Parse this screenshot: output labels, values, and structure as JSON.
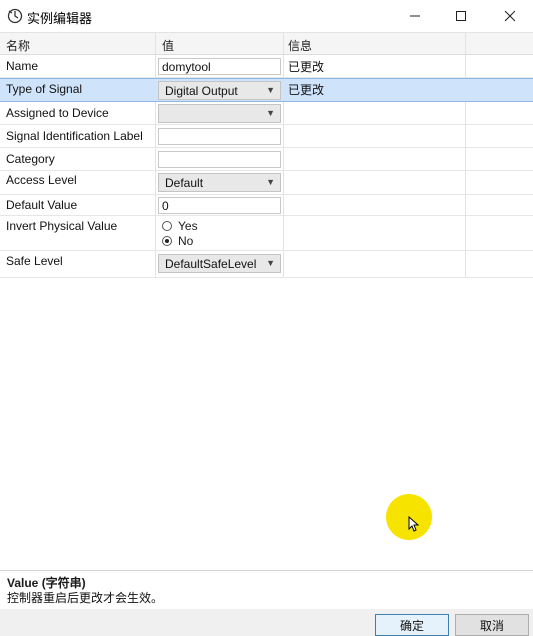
{
  "window": {
    "title": "实例编辑器"
  },
  "columns": {
    "name": "名称",
    "value": "值",
    "info": "信息"
  },
  "rows": [
    {
      "label": "Name",
      "value": "domytool",
      "info": "已更改"
    },
    {
      "label": "Type of Signal",
      "value": "Digital Output",
      "info": "已更改"
    },
    {
      "label": "Assigned to Device",
      "value": "",
      "info": ""
    },
    {
      "label": "Signal Identification Label",
      "value": "",
      "info": ""
    },
    {
      "label": "Category",
      "value": "",
      "info": ""
    },
    {
      "label": "Access Level",
      "value": "Default",
      "info": ""
    },
    {
      "label": "Default Value",
      "value": "0",
      "info": ""
    },
    {
      "label": "Invert Physical Value",
      "options": [
        "Yes",
        "No"
      ],
      "selected": "No",
      "info": ""
    },
    {
      "label": "Safe Level",
      "value": "DefaultSafeLevel",
      "info": ""
    }
  ],
  "description": {
    "title": "Value (字符串)",
    "text": "控制器重启后更改才会生效。"
  },
  "buttons": {
    "ok": "确定",
    "cancel": "取消"
  },
  "colors": {
    "selected_row": "#cfe3fb",
    "cursor_highlight": "#f6e400"
  }
}
